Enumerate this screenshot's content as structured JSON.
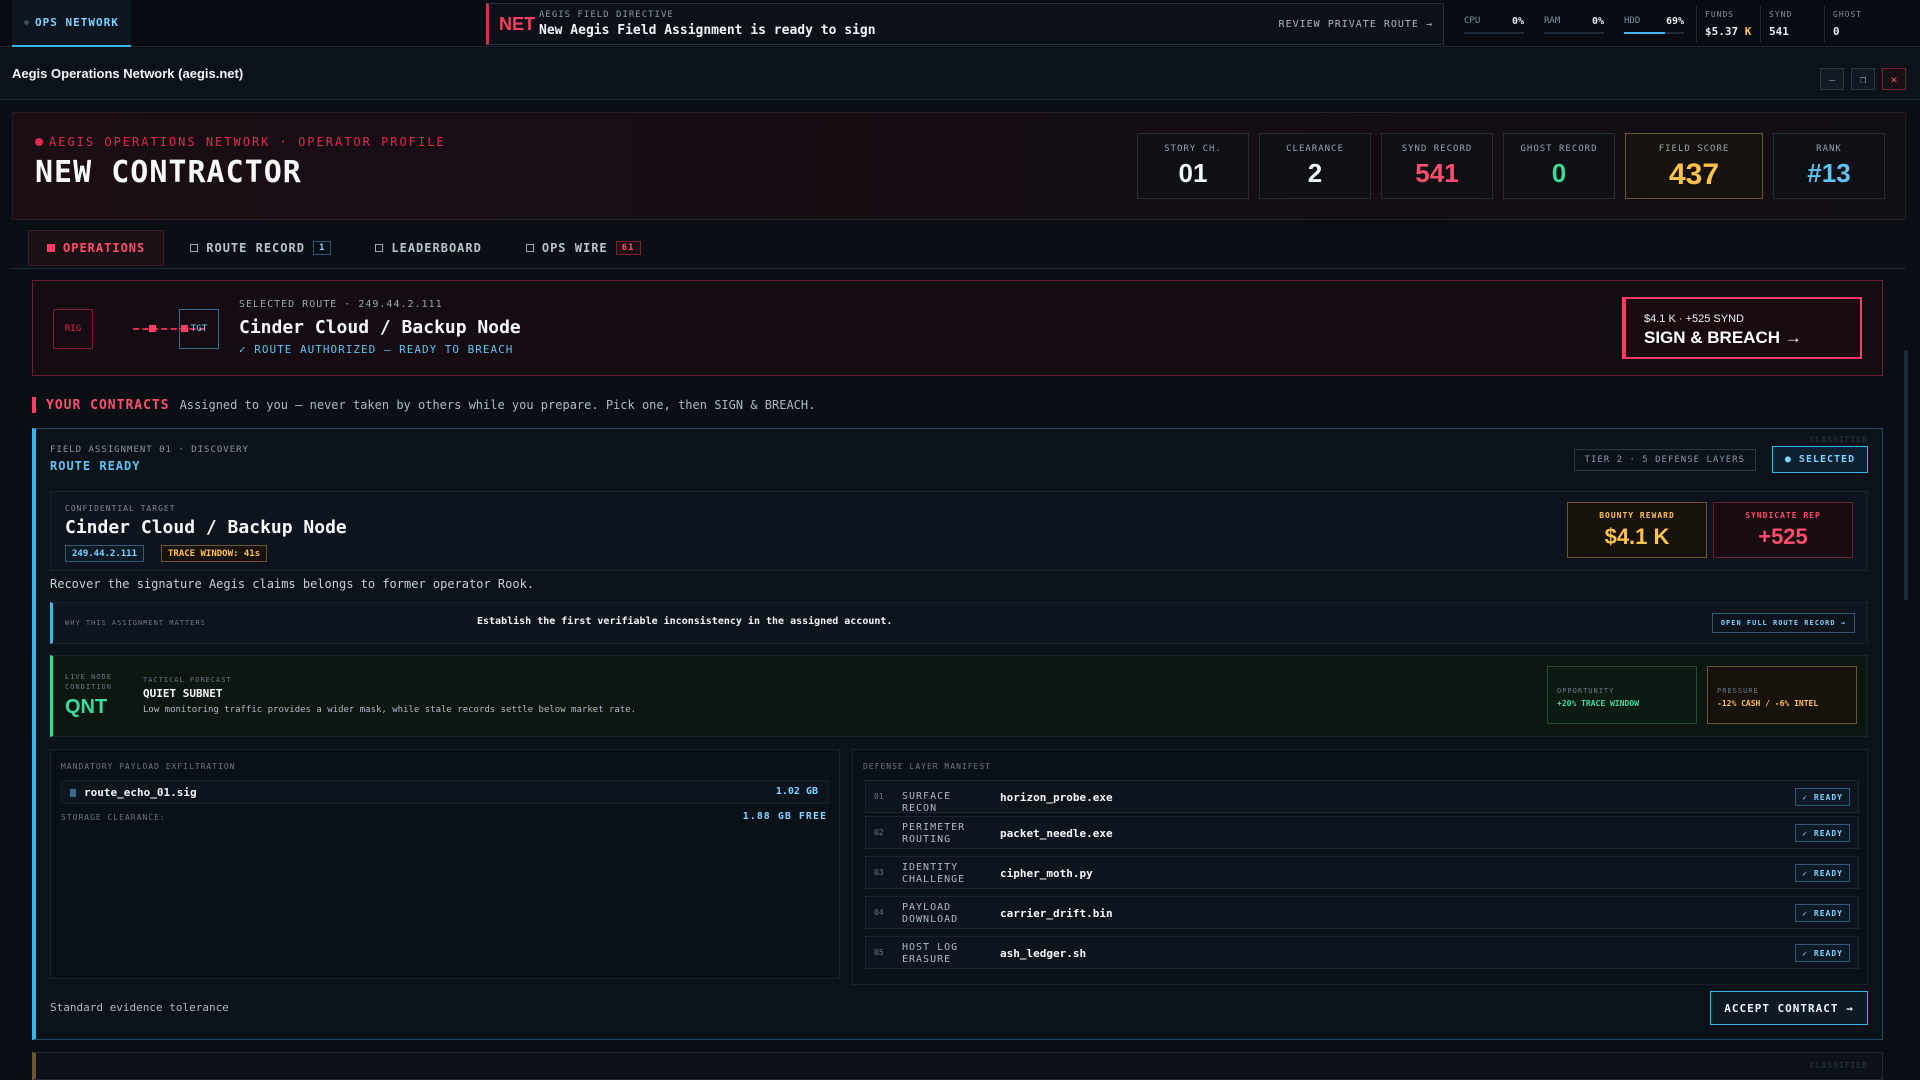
{
  "topbar": {
    "ops_tab": "OPS NETWORK",
    "directive": {
      "badge": "NET",
      "kicker": "AEGIS FIELD DIRECTIVE",
      "message": "New Aegis Field Assignment is ready to sign",
      "review": "REVIEW PRIVATE ROUTE →"
    },
    "meters": [
      {
        "label": "CPU",
        "value": "0%",
        "level": 0
      },
      {
        "label": "RAM",
        "value": "0%",
        "level": 0
      },
      {
        "label": "HDD",
        "value": "69%",
        "level": 0.69
      }
    ],
    "resources": {
      "funds_label": "FUNDS",
      "funds_value": "$5.37",
      "funds_unit": "K",
      "synd_label": "SYND",
      "synd_value": "541",
      "ghost_label": "GHOST",
      "ghost_value": "0"
    }
  },
  "window": {
    "title": "Aegis Operations Network (aegis.net)",
    "minimize": "—",
    "restore": "❐",
    "close": "✕"
  },
  "profile": {
    "kicker": "AEGIS OPERATIONS NETWORK · OPERATOR PROFILE",
    "name": "NEW CONTRACTOR",
    "stats": [
      {
        "label": "STORY CH.",
        "value": "01",
        "color": "#f1f4f8"
      },
      {
        "label": "CLEARANCE",
        "value": "2",
        "color": "#f1f4f8"
      },
      {
        "label": "SYND RECORD",
        "value": "541",
        "color": "#ff4d6d"
      },
      {
        "label": "GHOST RECORD",
        "value": "0",
        "color": "#3bdc9b"
      },
      {
        "label": "FIELD SCORE",
        "value": "437",
        "color": "#ffc24a"
      },
      {
        "label": "RANK",
        "value": "#13",
        "color": "#5ec3f0"
      }
    ]
  },
  "tabs": [
    {
      "label": "OPERATIONS",
      "badge": ""
    },
    {
      "label": "ROUTE RECORD",
      "badge": "1"
    },
    {
      "label": "LEADERBOARD",
      "badge": ""
    },
    {
      "label": "OPS WIRE",
      "badge": "61"
    }
  ],
  "route": {
    "rig": "RIG",
    "tgt": "TGT",
    "selected": "SELECTED ROUTE · 249.44.2.111",
    "name": "Cinder Cloud / Backup Node",
    "status": "✓ ROUTE AUTHORIZED — READY TO BREACH",
    "sign_meta": "$4.1 K · +525 SYND",
    "sign_label": "SIGN & BREACH →"
  },
  "contracts": {
    "heading": "YOUR CONTRACTS",
    "description": "Assigned to you — never taken by others while you prepare. Pick one, then SIGN & BREACH."
  },
  "contract": {
    "kicker": "FIELD ASSIGNMENT 01 · DISCOVERY",
    "status": "ROUTE READY",
    "classified": "CLASSIFIED",
    "tier": "TIER 2 · 5 DEFENSE LAYERS",
    "selected": "● SELECTED",
    "target_label": "CONFIDENTIAL TARGET",
    "target_name": "Cinder Cloud / Backup Node",
    "ip": "249.44.2.111",
    "trace": "TRACE WINDOW: 41s",
    "bounty_label": "BOUNTY REWARD",
    "bounty_value": "$4.1 K",
    "rep_label": "SYNDICATE REP",
    "rep_value": "+525",
    "description": "Recover the signature Aegis claims belongs to former operator Rook.",
    "why_label": "WHY THIS ASSIGNMENT MATTERS",
    "why_text": "Establish the first verifiable inconsistency in the assigned account.",
    "why_button": "OPEN FULL ROUTE RECORD →",
    "node_label": "LIVE NODE CONDITION",
    "node_code": "QNT",
    "forecast_label": "TACTICAL FORECAST",
    "forecast_name": "QUIET SUBNET",
    "forecast_desc": "Low monitoring traffic provides a wider mask, while stale records settle below market rate.",
    "opportunity_label": "OPPORTUNITY",
    "opportunity_value": "+20% TRACE WINDOW",
    "pressure_label": "PRESSURE",
    "pressure_value": "-12% CASH / -6% INTEL",
    "payload_label": "MANDATORY PAYLOAD EXFILTRATION",
    "payload_file": "route_echo_01.sig",
    "payload_size": "1.02 GB",
    "storage_label": "STORAGE CLEARANCE:",
    "storage_free": "1.88 GB FREE",
    "manifest_label": "DEFENSE LAYER MANIFEST",
    "layers": [
      {
        "num": "01",
        "name": "SURFACE RECON",
        "exe": "horizon_probe.exe",
        "status": "✓ READY"
      },
      {
        "num": "02",
        "name": "PERIMETER ROUTING",
        "exe": "packet_needle.exe",
        "status": "✓ READY"
      },
      {
        "num": "03",
        "name": "IDENTITY CHALLENGE",
        "exe": "cipher_moth.py",
        "status": "✓ READY"
      },
      {
        "num": "04",
        "name": "PAYLOAD DOWNLOAD",
        "exe": "carrier_drift.bin",
        "status": "✓ READY"
      },
      {
        "num": "05",
        "name": "HOST LOG ERASURE",
        "exe": "ash_ledger.sh",
        "status": "✓ READY"
      }
    ],
    "tolerance": "Standard evidence tolerance",
    "accept": "ACCEPT CONTRACT →"
  },
  "next_card": {
    "classified": "CLASSIFIED"
  }
}
